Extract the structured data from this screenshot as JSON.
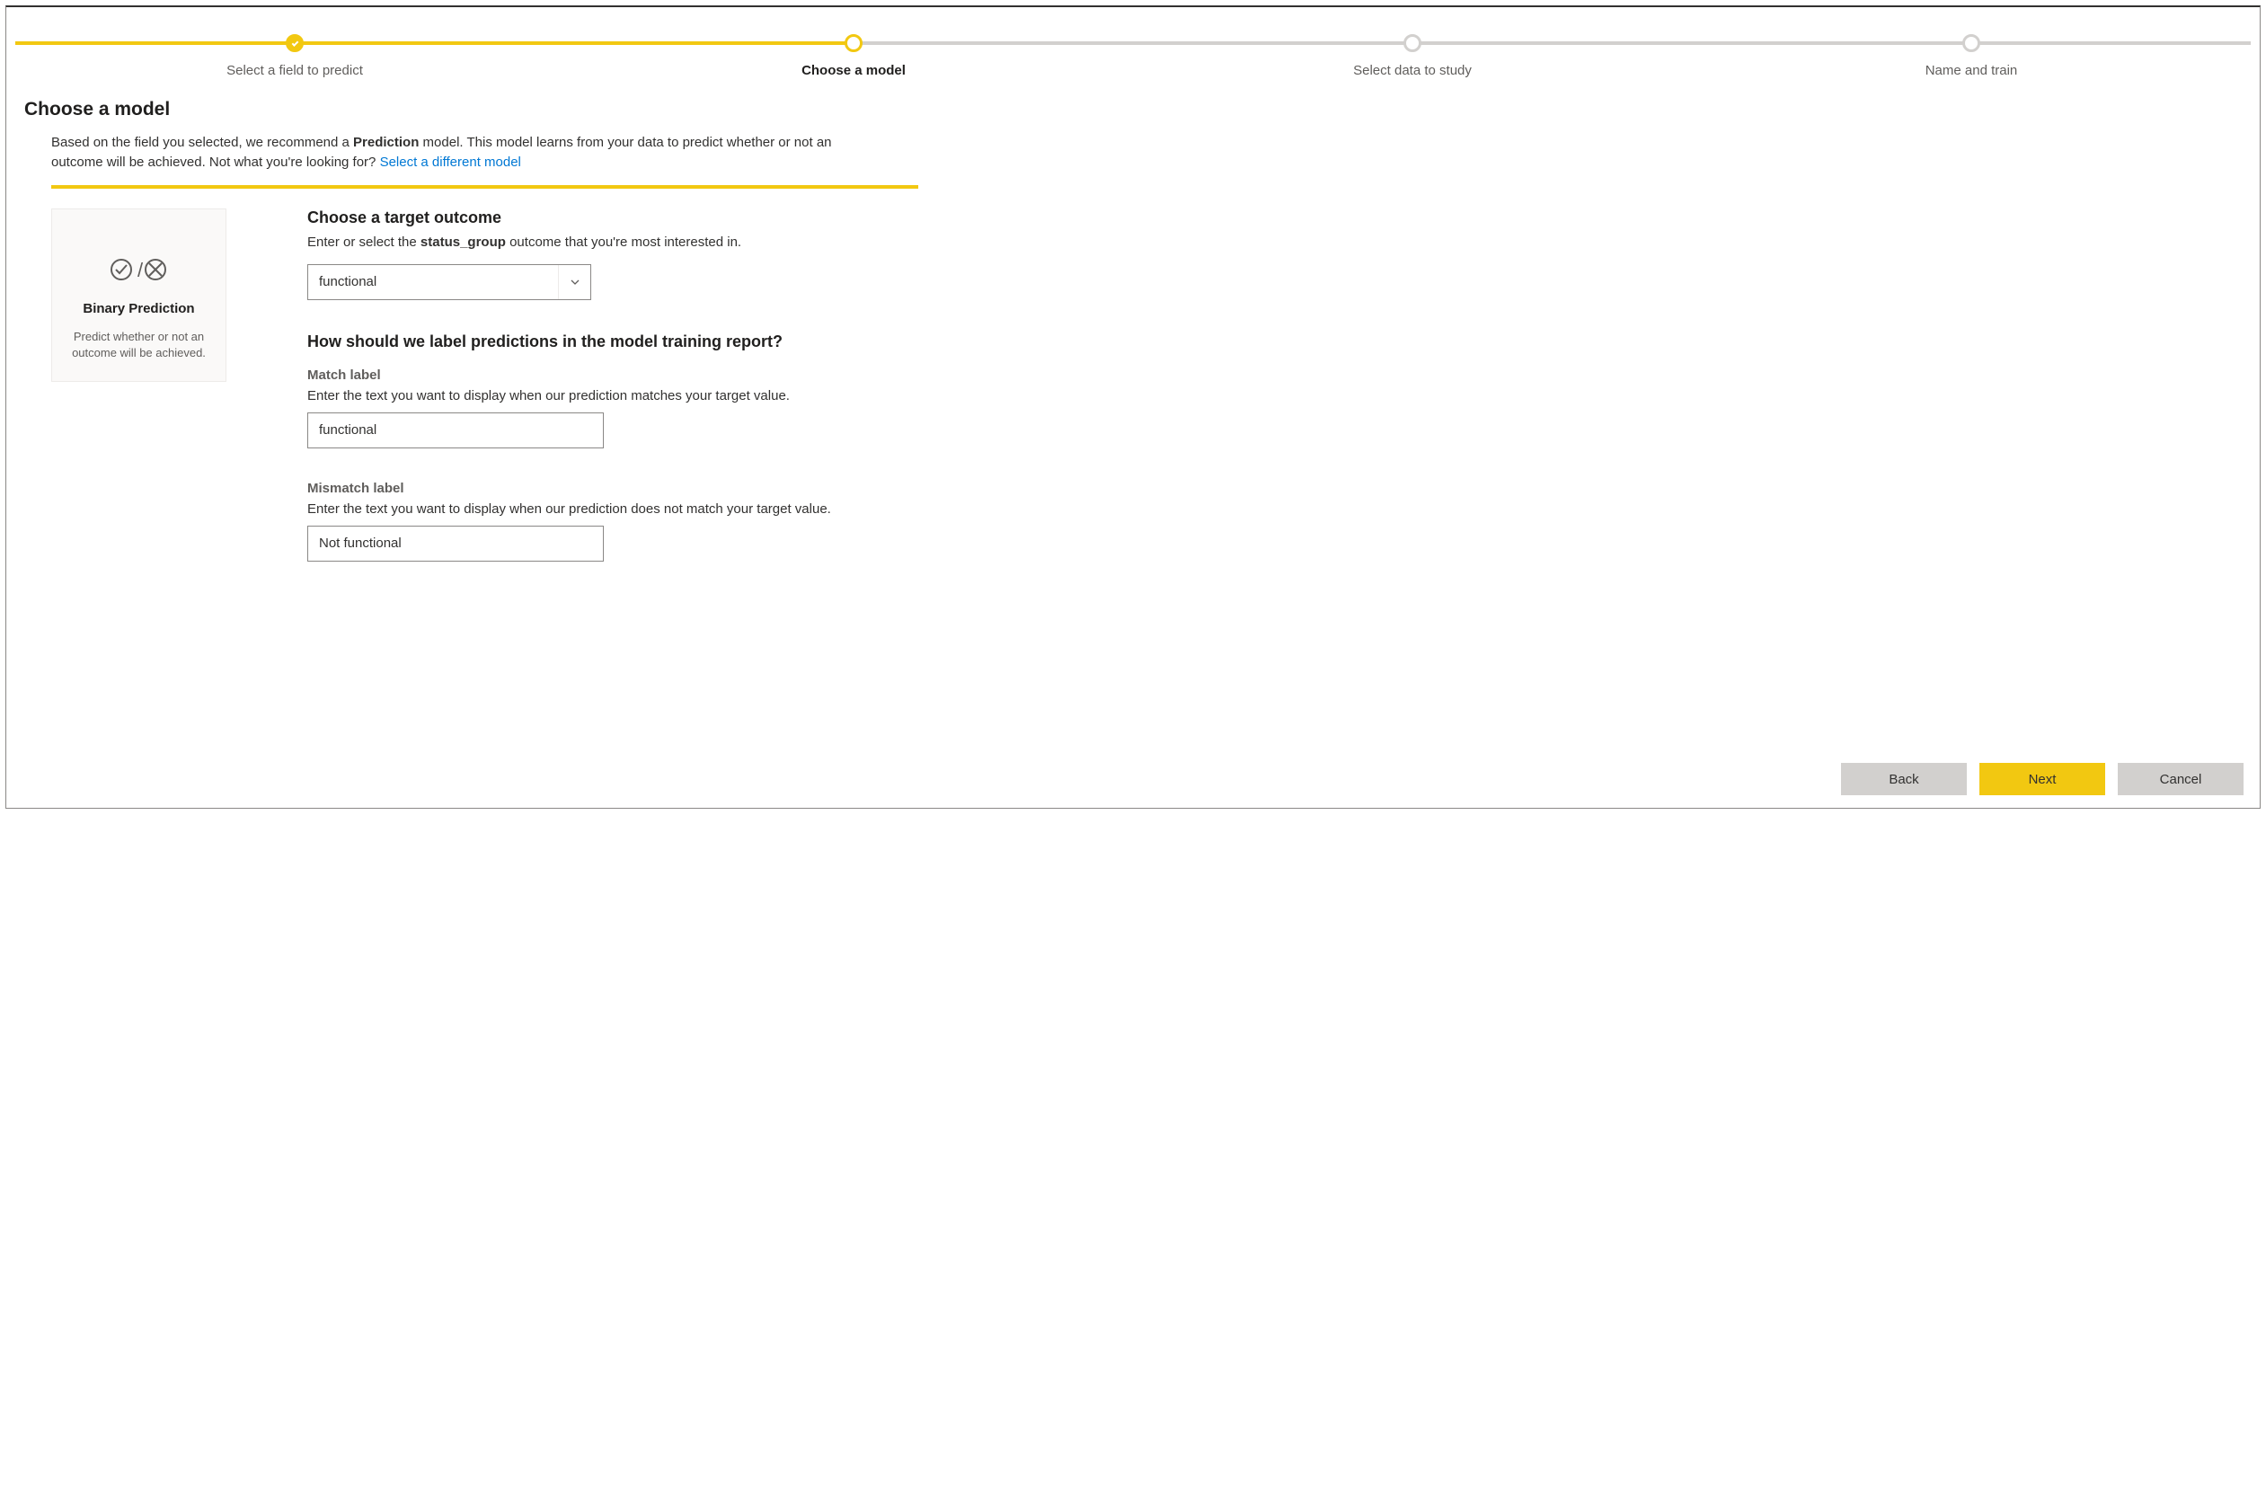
{
  "stepper": {
    "steps": [
      {
        "label": "Select a field to predict",
        "state": "done"
      },
      {
        "label": "Choose a model",
        "state": "current"
      },
      {
        "label": "Select data to study",
        "state": "future"
      },
      {
        "label": "Name and train",
        "state": "future"
      }
    ],
    "done_fraction_percent": 37.5
  },
  "page_title": "Choose a model",
  "intro": {
    "prefix": "Based on the field you selected, we recommend a ",
    "model_word": "Prediction",
    "middle": " model. This model learns from your data to predict whether or not an outcome will be achieved. Not what you're looking for? ",
    "link_text": "Select a different model"
  },
  "model_card": {
    "title": "Binary Prediction",
    "description": "Predict whether or not an outcome will be achieved."
  },
  "target_outcome": {
    "heading": "Choose a target outcome",
    "sub_prefix": "Enter or select the ",
    "field_name": "status_group",
    "sub_suffix": " outcome that you're most interested in.",
    "selected": "functional"
  },
  "labels_section": {
    "heading": "How should we label predictions in the model training report?",
    "match": {
      "label": "Match label",
      "help": "Enter the text you want to display when our prediction matches your target value.",
      "value": "functional"
    },
    "mismatch": {
      "label": "Mismatch label",
      "help": "Enter the text you want to display when our prediction does not match your target value.",
      "value": "Not functional"
    }
  },
  "footer": {
    "back": "Back",
    "next": "Next",
    "cancel": "Cancel"
  }
}
